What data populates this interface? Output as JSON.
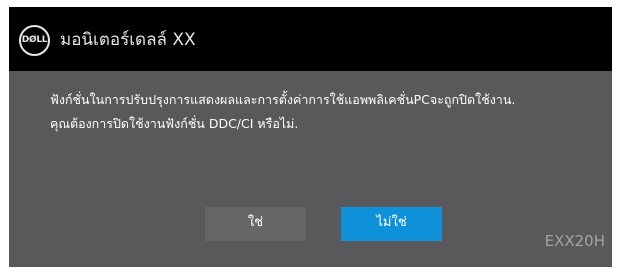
{
  "dialog": {
    "logo_text": "DØLL",
    "title": "มอนิเตอร์เดลล์ XX",
    "message_line1": "ฟังก์ชั่นในการปรับปรุงการแสดงผลและการตั้งค่าการใช้แอพพลิเคชั่นPCจะถูกปิดใช้งาน.",
    "message_line2": "คุณต้องการปิดใช้งานฟังก์ชั่น DDC/CI หรือไม่.",
    "yes_label": "ใช่",
    "no_label": "ไม่ใช่",
    "model": "EXX20H"
  },
  "colors": {
    "title_bar": "#000000",
    "body": "#59595b",
    "yes_button": "#666668",
    "no_button_selected": "#0e91d8",
    "model_text": "#a3a3a3"
  },
  "icons": {
    "logo": "dell-logo-icon"
  }
}
